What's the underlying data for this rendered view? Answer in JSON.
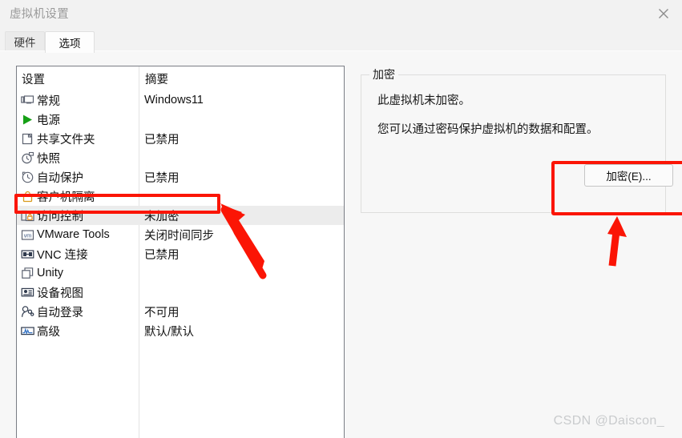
{
  "window": {
    "title": "虚拟机设置",
    "close_icon": "close-icon"
  },
  "tabs": [
    {
      "label": "硬件",
      "active": false
    },
    {
      "label": "选项",
      "active": true
    }
  ],
  "settings_list": {
    "columns": [
      "设置",
      "摘要"
    ],
    "rows": [
      {
        "icon": "monitor-icon",
        "label": "常规",
        "summary": "Windows11",
        "selected": false
      },
      {
        "icon": "play-icon",
        "label": "电源",
        "summary": "",
        "selected": false
      },
      {
        "icon": "shared-folder-icon",
        "label": "共享文件夹",
        "summary": "已禁用",
        "selected": false
      },
      {
        "icon": "snapshot-icon",
        "label": "快照",
        "summary": "",
        "selected": false
      },
      {
        "icon": "autoprotect-icon",
        "label": "自动保护",
        "summary": "已禁用",
        "selected": false
      },
      {
        "icon": "guest-isolation-icon",
        "label": "客户机隔离",
        "summary": "",
        "selected": false
      },
      {
        "icon": "access-control-icon",
        "label": "访问控制",
        "summary": "未加密",
        "selected": true
      },
      {
        "icon": "vmware-tools-icon",
        "label": "VMware Tools",
        "summary": "关闭时间同步",
        "selected": false
      },
      {
        "icon": "vnc-icon",
        "label": "VNC 连接",
        "summary": "已禁用",
        "selected": false
      },
      {
        "icon": "unity-icon",
        "label": "Unity",
        "summary": "",
        "selected": false
      },
      {
        "icon": "device-view-icon",
        "label": "设备视图",
        "summary": "",
        "selected": false
      },
      {
        "icon": "auto-login-icon",
        "label": "自动登录",
        "summary": "不可用",
        "selected": false
      },
      {
        "icon": "advanced-icon",
        "label": "高级",
        "summary": "默认/默认",
        "selected": false
      }
    ]
  },
  "encryption_panel": {
    "group_title": "加密",
    "line1": "此虚拟机未加密。",
    "line2": "您可以通过密码保护虚拟机的数据和配置。",
    "button_label": "加密(E)..."
  },
  "annotations": {
    "highlight_color": "#fb1505",
    "arrow_count": 2
  },
  "watermark": "CSDN @Daiscon_"
}
